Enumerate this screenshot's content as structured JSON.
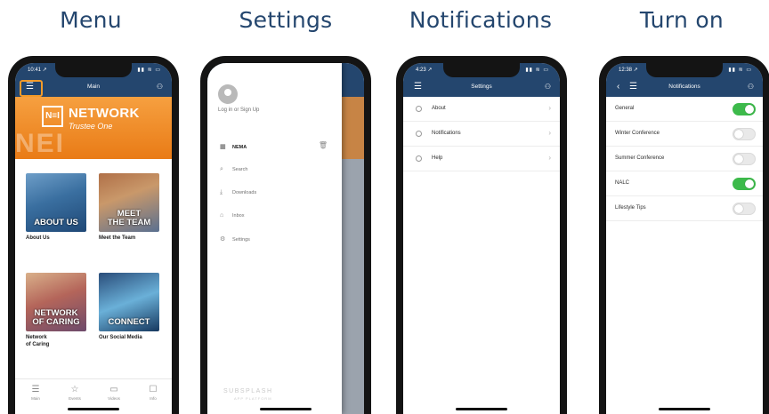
{
  "headings": [
    "Menu",
    "Settings",
    "Notifications",
    "Turn on"
  ],
  "colors": {
    "brand_navy": "#24466e",
    "brand_orange": "#e97b16",
    "highlight_orange": "#f39b2a",
    "toggle_on": "#3dba4b"
  },
  "status": {
    "time_1": "10:41 ↗",
    "time_3": "4:23 ↗",
    "time_4": "12:38 ↗",
    "icons": "▮▮ ≋ ▭"
  },
  "menu_screen": {
    "nav_title": "Main",
    "menu_icon": "hamburger-icon",
    "profile_icon": "profile-icon",
    "banner": {
      "logo": "N≡I",
      "title": "NETWORK",
      "subtitle": "Trustee One",
      "background_text": "NEI"
    },
    "tiles": [
      {
        "label": "ABOUT US",
        "caption": "About Us"
      },
      {
        "label": "MEET\nTHE TEAM",
        "caption": "Meet the Team"
      },
      {
        "label": "NETWORK\nOF CARING",
        "caption": "Network\nof Caring"
      },
      {
        "label": "CONNECT",
        "caption": "Our Social Media"
      }
    ],
    "tabs": [
      {
        "icon": "☰",
        "label": "Main"
      },
      {
        "icon": "☆",
        "label": "Events"
      },
      {
        "icon": "▭",
        "label": "Videos"
      },
      {
        "icon": "☐",
        "label": "Info"
      }
    ]
  },
  "settings_screen": {
    "login_text": "Log in or Sign Up",
    "items": [
      {
        "icon": "▦",
        "label": "NEMA"
      },
      {
        "icon": "⌕",
        "label": "Search"
      },
      {
        "icon": "⤓",
        "label": "Downloads"
      },
      {
        "icon": "⌂",
        "label": "Inbox"
      },
      {
        "icon": "⚙",
        "label": "Settings"
      }
    ],
    "brand": "SUBSPLASH",
    "brand_sub": "APP PLATFORM"
  },
  "notifications_screen": {
    "nav_title": "Settings",
    "rows": [
      {
        "label": "About"
      },
      {
        "label": "Notifications"
      },
      {
        "label": "Help"
      }
    ]
  },
  "turnon_screen": {
    "nav_title": "Notifications",
    "back_icon": "‹",
    "rows": [
      {
        "label": "General",
        "on": true
      },
      {
        "label": "Winter Conference",
        "on": false
      },
      {
        "label": "Summer Conference",
        "on": false
      },
      {
        "label": "NALC",
        "on": true
      },
      {
        "label": "Lifestyle Tips",
        "on": false
      }
    ]
  }
}
